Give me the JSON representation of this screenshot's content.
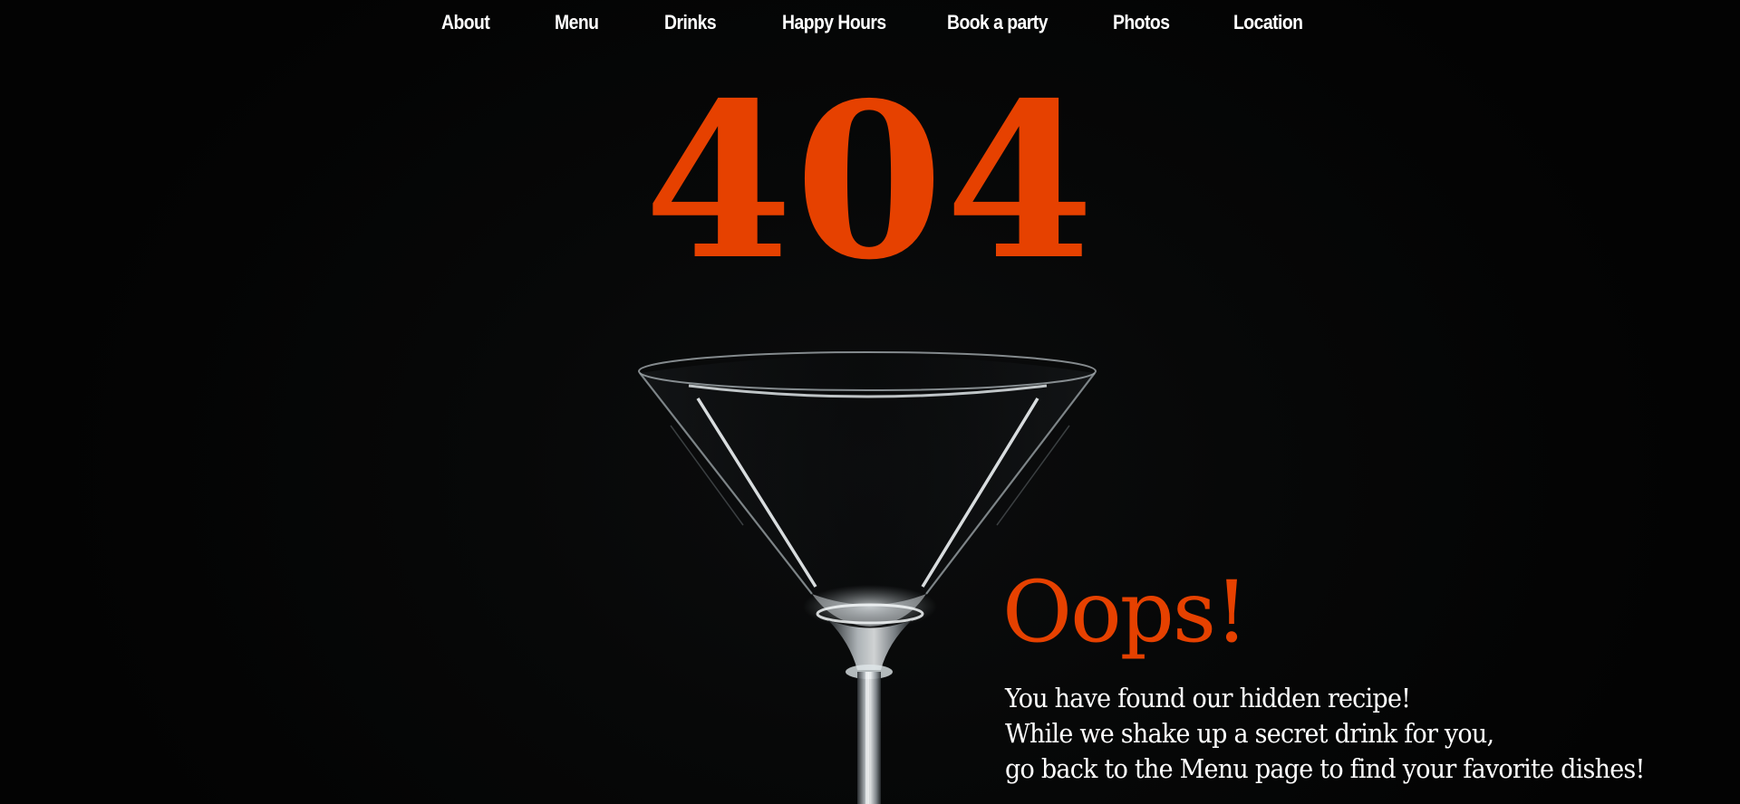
{
  "colors": {
    "accent": "#e64100",
    "background": "#050505",
    "text": "#ffffff"
  },
  "nav": {
    "items": [
      {
        "label": "About"
      },
      {
        "label": "Menu"
      },
      {
        "label": "Drinks"
      },
      {
        "label": "Happy Hours"
      },
      {
        "label": "Book a party"
      },
      {
        "label": "Photos"
      },
      {
        "label": "Location"
      }
    ]
  },
  "hero": {
    "code": "404",
    "image_icon": "martini-glass"
  },
  "error": {
    "heading": "Oops!",
    "lines": [
      "You have found our hidden recipe!",
      "While we shake up a secret drink for you,",
      "go back to the Menu page to find your favorite dishes!"
    ]
  }
}
